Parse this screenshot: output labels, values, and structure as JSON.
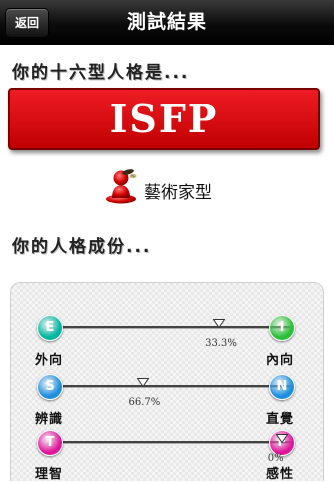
{
  "navbar": {
    "back_label": "返回",
    "title": "測試結果"
  },
  "result": {
    "heading": "你的十六型人格是...",
    "type_code": "ISFP",
    "type_name": "藝術家型",
    "icon": "red-person-artist-icon"
  },
  "breakdown": {
    "heading": "你的人格成份...",
    "dimensions": [
      {
        "left_letter": "E",
        "left_label": "外向",
        "left_color": "#00b5a0",
        "right_letter": "I",
        "right_label": "內向",
        "right_color": "#2bbf37",
        "percent_text": "33.3%",
        "marker_fraction": 0.69
      },
      {
        "left_letter": "S",
        "left_label": "辨識",
        "left_color": "#1e8fe0",
        "right_letter": "N",
        "right_label": "直覺",
        "right_color": "#1e8fe0",
        "percent_text": "66.7%",
        "marker_fraction": 0.36
      },
      {
        "left_letter": "T",
        "left_label": "理智",
        "left_color": "#e0179b",
        "right_letter": "F",
        "right_label": "感性",
        "right_color": "#e0179b",
        "percent_text": "0%",
        "marker_fraction": 0.96
      }
    ]
  }
}
